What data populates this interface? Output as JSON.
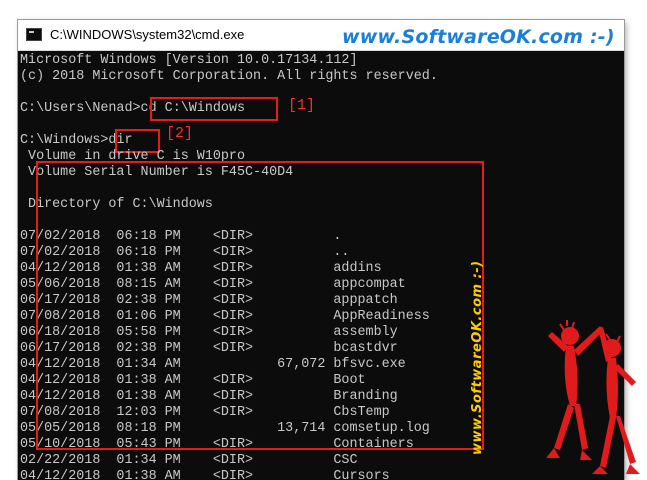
{
  "window": {
    "title": "C:\\WINDOWS\\system32\\cmd.exe"
  },
  "brand": {
    "header": "www.SoftwareOK.com :-)",
    "vertical": "www.SoftwareOK.com :-)",
    "accent_blue": "#1a7fd6",
    "accent_yellow": "#ffcc00",
    "highlight_red": "#e81a1a"
  },
  "terminal": {
    "header_lines": [
      "Microsoft Windows [Version 10.0.17134.112]",
      "(c) 2018 Microsoft Corporation. All rights reserved."
    ],
    "prompt1": "C:\\Users\\Nenad>",
    "command1": "cd C:\\Windows",
    "marker1": "[1]",
    "prompt2": "C:\\Windows>",
    "command2": "dir",
    "marker2": "[2]",
    "volume_lines": [
      " Volume in drive C is W10pro",
      " Volume Serial Number is F45C-40D4"
    ],
    "directory_header": " Directory of C:\\Windows",
    "listing": [
      "07/02/2018  06:18 PM    <DIR>          .",
      "07/02/2018  06:18 PM    <DIR>          ..",
      "04/12/2018  01:38 AM    <DIR>          addins",
      "05/06/2018  08:15 AM    <DIR>          appcompat",
      "06/17/2018  02:38 PM    <DIR>          apppatch",
      "07/08/2018  01:06 PM    <DIR>          AppReadiness",
      "06/18/2018  05:58 PM    <DIR>          assembly",
      "06/17/2018  02:38 PM    <DIR>          bcastdvr",
      "04/12/2018  01:34 AM            67,072 bfsvc.exe",
      "04/12/2018  01:38 AM    <DIR>          Boot",
      "04/12/2018  01:38 AM    <DIR>          Branding",
      "07/08/2018  12:03 PM    <DIR>          CbsTemp",
      "05/05/2018  08:18 PM            13,714 comsetup.log",
      "05/10/2018  05:43 PM    <DIR>          Containers",
      "02/22/2018  01:34 PM    <DIR>          CSC",
      "04/12/2018  01:38 AM    <DIR>          Cursors"
    ]
  }
}
